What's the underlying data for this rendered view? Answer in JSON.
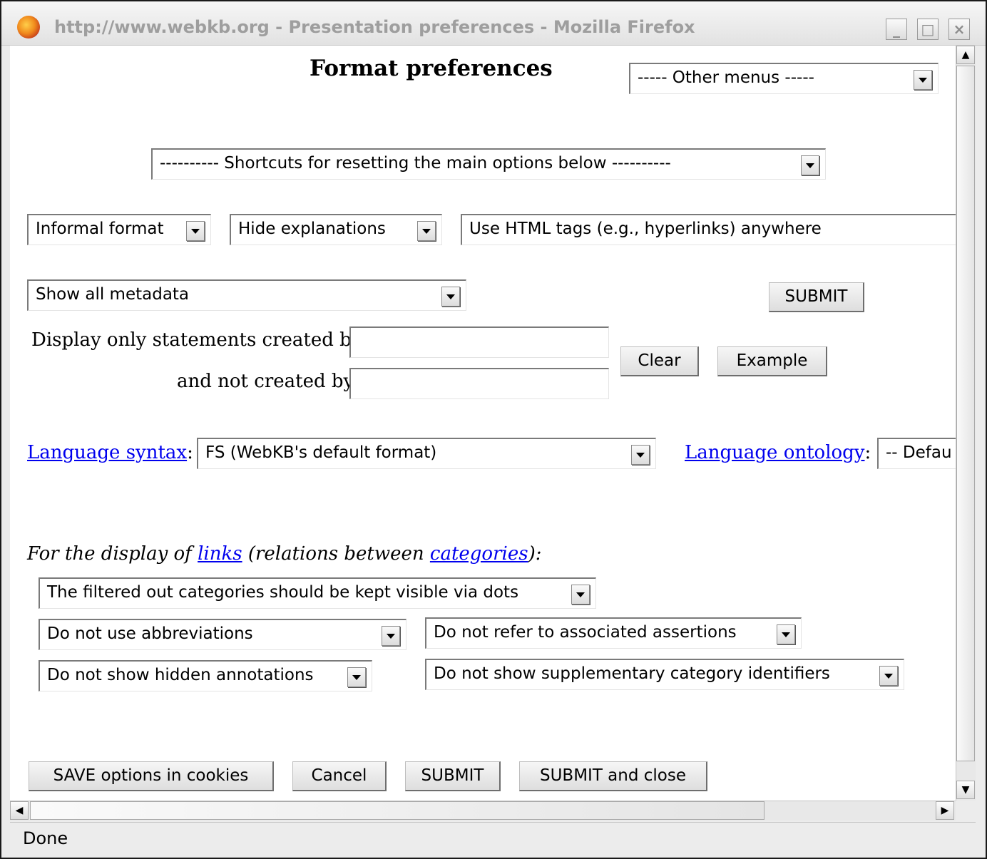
{
  "window": {
    "title": "http://www.webkb.org - Presentation preferences - Mozilla Firefox",
    "minimize_label": "_",
    "maximize_label": "□",
    "close_label": "×"
  },
  "page": {
    "title": "Format preferences",
    "other_menus": "----- Other menus -----",
    "shortcuts": "---------- Shortcuts for resetting the main options below ----------",
    "format_select": "Informal format",
    "explanations_select": "Hide explanations",
    "html_tags_select": "Use HTML tags (e.g., hyperlinks) anywhere",
    "metadata_select": "Show all metadata",
    "submit_top": "SUBMIT",
    "created_by_label": "Display only statements created by",
    "not_created_by_label": "and not created by",
    "created_by_value": "",
    "not_created_by_value": "",
    "clear_button": "Clear",
    "example_button": "Example",
    "language_syntax_link": "Language syntax",
    "colon": ":",
    "syntax_select": "FS (WebKB's default format)",
    "language_ontology_link": "Language ontology",
    "ontology_select": "-- Defau",
    "links_section": {
      "prefix": "For the display of ",
      "links_link": "links",
      "middle": " (relations between ",
      "categories_link": "categories",
      "suffix": "):"
    },
    "filtered_select": "The filtered out categories should be kept visible via dots",
    "abbrev_select": "Do not use abbreviations",
    "assertions_select": "Do not refer to associated assertions",
    "hidden_select": "Do not show hidden annotations",
    "identifiers_select": "Do not show supplementary category identifiers",
    "save_button": "SAVE options in cookies",
    "cancel_button": "Cancel",
    "submit_button": "SUBMIT",
    "submit_close_button": "SUBMIT and close"
  },
  "status": {
    "text": "Done"
  }
}
